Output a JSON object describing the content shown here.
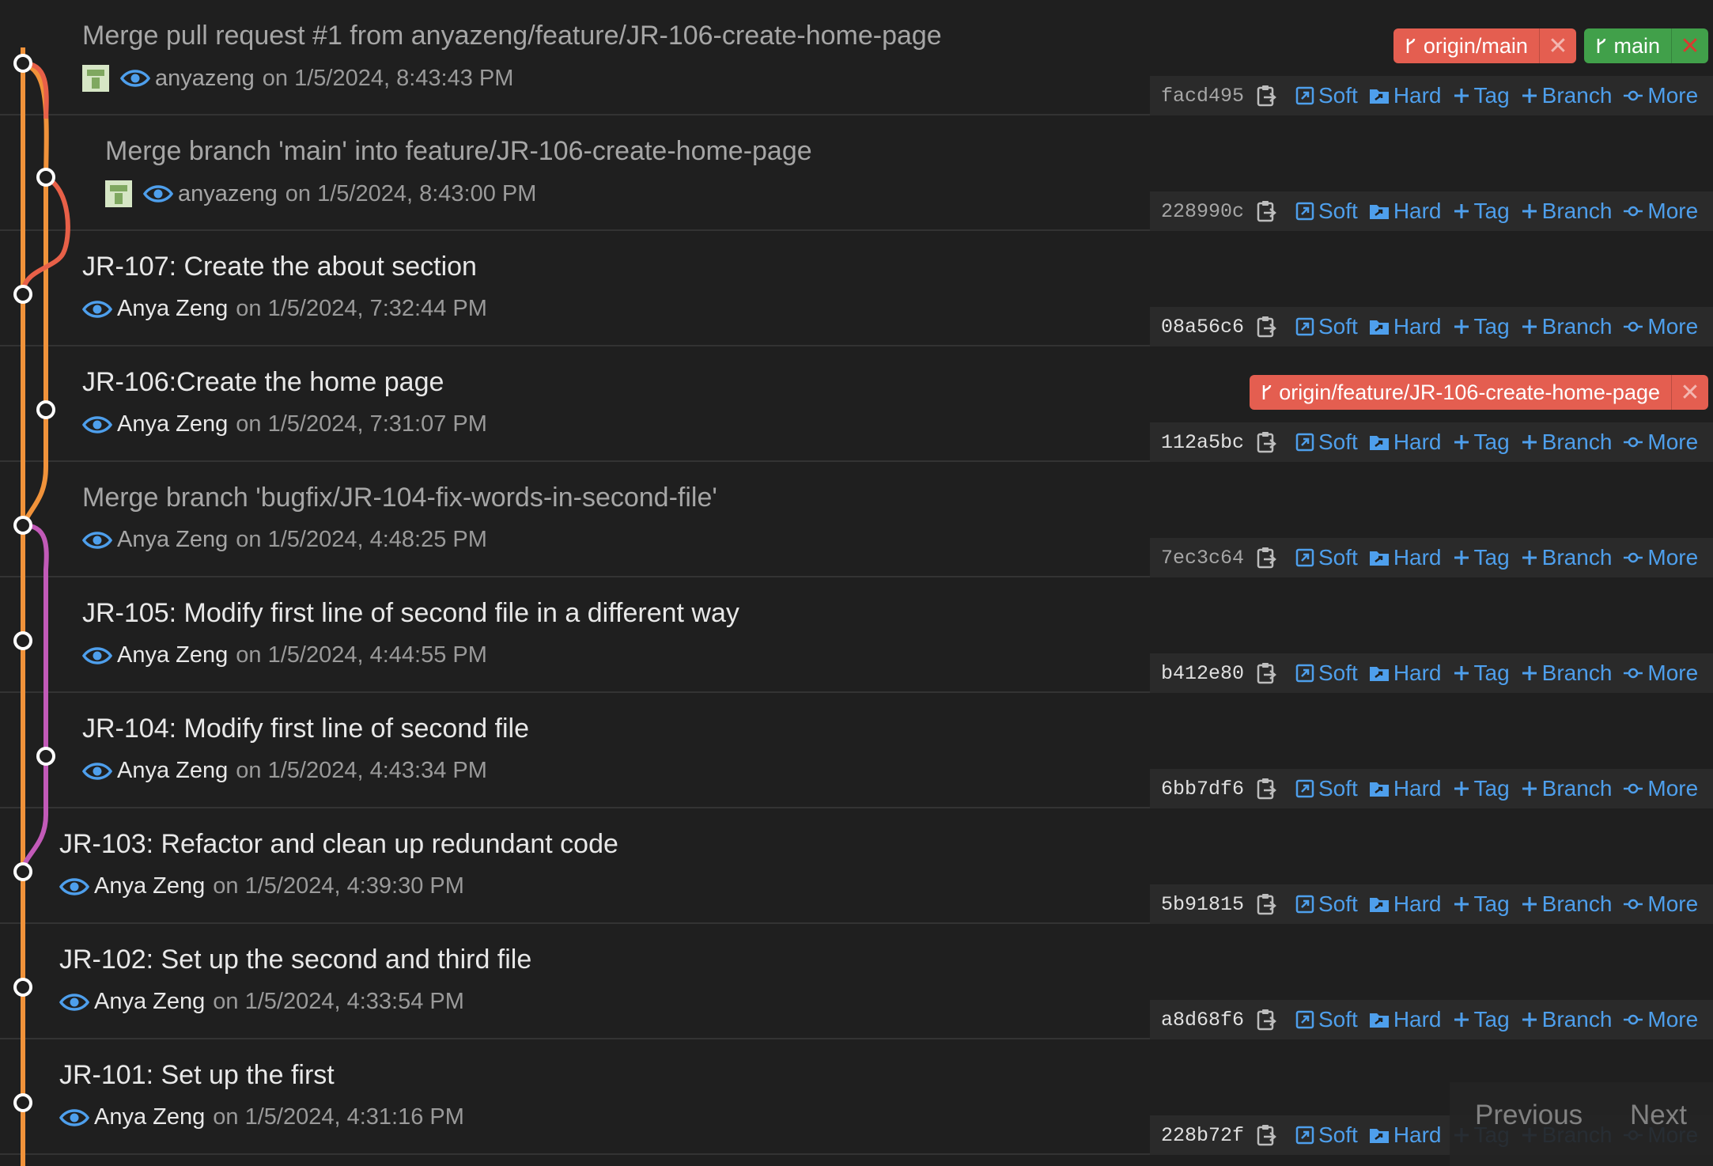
{
  "actions": {
    "soft": "Soft",
    "hard": "Hard",
    "tag": "Tag",
    "branch": "Branch",
    "more": "More"
  },
  "commits": [
    {
      "message": "Merge pull request #1 from anyazeng/feature/JR-106-create-home-page",
      "author": "anyazeng",
      "datetime": "on 1/5/2024, 8:43:43 PM",
      "hash": "facd495",
      "dim": true,
      "avatar": true
    },
    {
      "message": "Merge branch 'main' into feature/JR-106-create-home-page",
      "author": "anyazeng",
      "datetime": "on 1/5/2024, 8:43:00 PM",
      "hash": "228990c",
      "dim": true,
      "avatar": true
    },
    {
      "message": "JR-107: Create the about section",
      "author": "Anya Zeng",
      "datetime": "on 1/5/2024, 7:32:44 PM",
      "hash": "08a56c6",
      "dim": false,
      "avatar": false
    },
    {
      "message": "JR-106:Create the home page",
      "author": "Anya Zeng",
      "datetime": "on 1/5/2024, 7:31:07 PM",
      "hash": "112a5bc",
      "dim": false,
      "avatar": false
    },
    {
      "message": "Merge branch 'bugfix/JR-104-fix-words-in-second-file'",
      "author": "Anya Zeng",
      "datetime": "on 1/5/2024, 4:48:25 PM",
      "hash": "7ec3c64",
      "dim": true,
      "avatar": false
    },
    {
      "message": "JR-105: Modify first line of second file in a different way",
      "author": "Anya Zeng",
      "datetime": "on 1/5/2024, 4:44:55 PM",
      "hash": "b412e80",
      "dim": false,
      "avatar": false
    },
    {
      "message": "JR-104: Modify first line of second file",
      "author": "Anya Zeng",
      "datetime": "on 1/5/2024, 4:43:34 PM",
      "hash": "6bb7df6",
      "dim": false,
      "avatar": false
    },
    {
      "message": "JR-103: Refactor and clean up redundant code",
      "author": "Anya Zeng",
      "datetime": "on 1/5/2024, 4:39:30 PM",
      "hash": "5b91815",
      "dim": false,
      "avatar": false
    },
    {
      "message": "JR-102: Set up the second and third file",
      "author": "Anya Zeng",
      "datetime": "on 1/5/2024, 4:33:54 PM",
      "hash": "a8d68f6",
      "dim": false,
      "avatar": false
    },
    {
      "message": "JR-101: Set up the first",
      "author": "Anya Zeng",
      "datetime": "on 1/5/2024, 4:31:16 PM",
      "hash": "228b72f",
      "dim": false,
      "avatar": false
    }
  ],
  "badges": {
    "origin_main": "origin/main",
    "main": "main",
    "origin_feature": "origin/feature/JR-106-create-home-page",
    "close": "✕"
  },
  "pagination": {
    "previous": "Previous",
    "next": "Next"
  },
  "colors": {
    "background": "#1f1f1f",
    "action_blue": "#4e9fec",
    "graph_main": "#f0923a",
    "graph_feature": "#e86048",
    "graph_bugfix": "#c25ab8",
    "badge_remote": "#e45e50",
    "badge_local": "#41a04a"
  }
}
